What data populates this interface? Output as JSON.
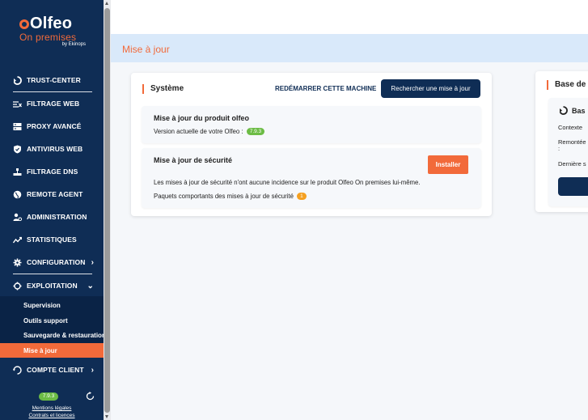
{
  "brand": {
    "name": "Olfeo",
    "product": "On premises",
    "by": "by Ekinops"
  },
  "sidebar": {
    "items": [
      {
        "label": "TRUST-CENTER",
        "icon": "trust-center-icon"
      },
      {
        "label": "FILTRAGE WEB",
        "icon": "web-filter-icon"
      },
      {
        "label": "PROXY AVANCÉ",
        "icon": "proxy-icon"
      },
      {
        "label": "ANTIVIRUS WEB",
        "icon": "shield-icon"
      },
      {
        "label": "FILTRAGE DNS",
        "icon": "dns-icon"
      },
      {
        "label": "REMOTE AGENT",
        "icon": "globe-icon"
      },
      {
        "label": "ADMINISTRATION",
        "icon": "admin-users-icon"
      },
      {
        "label": "STATISTIQUES",
        "icon": "chart-icon"
      },
      {
        "label": "CONFIGURATION",
        "icon": "gear-icon"
      },
      {
        "label": "EXPLOITATION",
        "icon": "operations-icon"
      },
      {
        "label": "COMPTE CLIENT",
        "icon": "account-icon"
      }
    ],
    "subitems": [
      {
        "label": "Supervision"
      },
      {
        "label": "Outils support"
      },
      {
        "label": "Sauvegarde & restauration"
      },
      {
        "label": "Mise à jour",
        "active": true
      }
    ],
    "version": "7.9.3",
    "footer": {
      "legal": "Mentions légales",
      "contracts": "Contrats et licences"
    }
  },
  "page": {
    "title": "Mise à jour"
  },
  "system_card": {
    "title": "Système",
    "restart_label": "REDÉMARRER CETTE MACHINE",
    "search_label": "Rechercher une mise à jour",
    "product": {
      "title": "Mise à jour du produit olfeo",
      "version_text": "Version actuelle de votre Olfeo :",
      "version": "7.9.3"
    },
    "security": {
      "title": "Mise à jour de sécurité",
      "install_label": "Installer",
      "note": "Les mises à jour de sécurité n'ont aucune incidence sur le produit Olfeo On premises lui-même.",
      "packages_text": "Paquets comportants des mises à jour de sécurité",
      "packages_count": "1"
    }
  },
  "base_card": {
    "title": "Base de",
    "sub_title": "Bas",
    "context_label": "Contexte",
    "reported_label": "Remontée",
    "reported_suffix": ":",
    "last_label": "Dernière s"
  },
  "colors": {
    "accent": "#f26a3a",
    "navy": "#0f2d55",
    "success": "#6cbc45",
    "warning": "#f5a020"
  }
}
